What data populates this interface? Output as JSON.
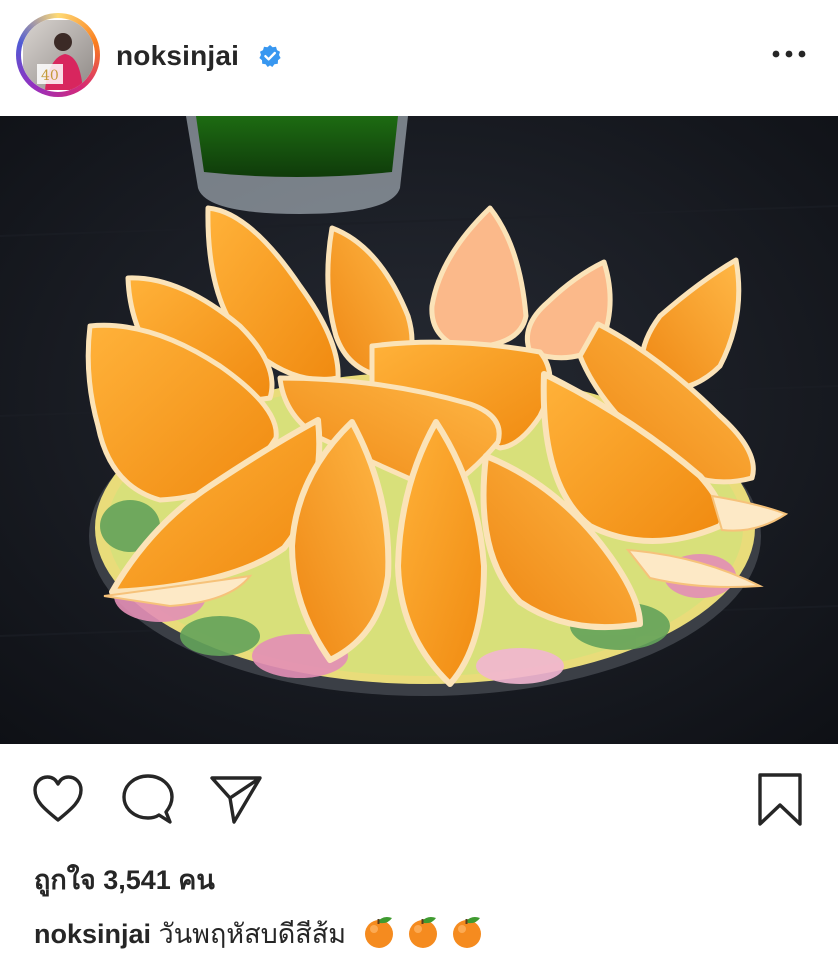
{
  "header": {
    "username": "noksinjai",
    "avatar_icon": "profile-photo",
    "verified_icon": "verified-badge-icon",
    "more_icon": "more-options-icon"
  },
  "photo": {
    "alt": "plate of orange wedges"
  },
  "actions": {
    "like_icon": "heart-icon",
    "comment_icon": "comment-icon",
    "share_icon": "send-icon",
    "save_icon": "bookmark-icon"
  },
  "likes": {
    "text": "ถูกใจ 3,541 คน"
  },
  "caption": {
    "username": "noksinjai",
    "text": "วันพฤหัสบดีสีส้ม",
    "emoji": [
      "🍊",
      "🍊",
      "🍊"
    ]
  },
  "colors": {
    "verified": "#3897f0",
    "text": "#262626",
    "photo_bg": "#14171d",
    "orange": "#f59a1b"
  }
}
